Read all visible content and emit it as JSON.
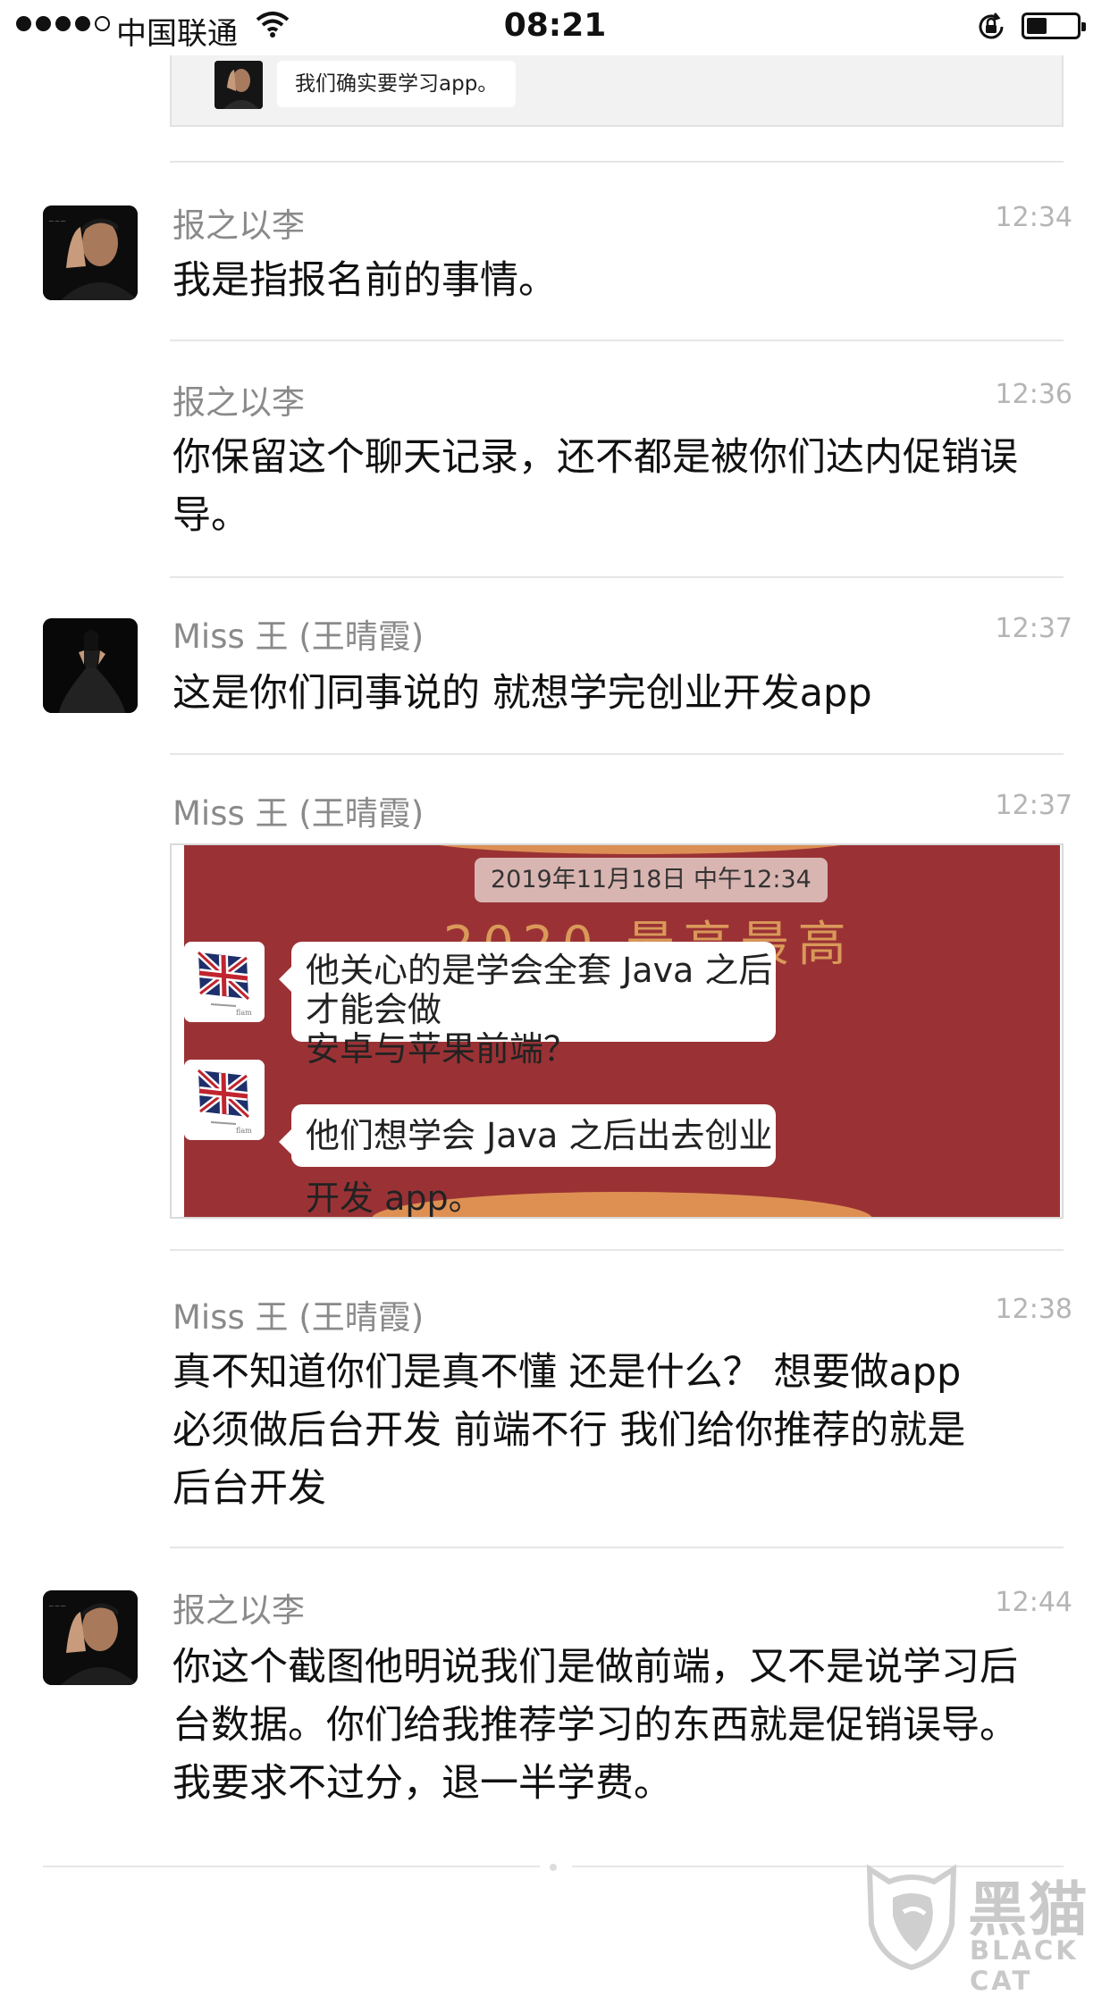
{
  "status_bar": {
    "carrier": "中国联通",
    "time": "08:21"
  },
  "quoted_message": {
    "text": "我们确实要学习app。"
  },
  "messages": [
    {
      "sender": "报之以李",
      "time": "12:34",
      "text": "我是指报名前的事情。"
    },
    {
      "sender": "报之以李",
      "time": "12:36",
      "lines": [
        "你保留这个聊天记录，还不都是被你们达内促销误",
        "导。"
      ]
    },
    {
      "sender": "Miss  王 (王晴霞)",
      "time": "12:37",
      "text": "这是你们同事说的  就想学完创业开发app"
    },
    {
      "sender": "Miss  王 (王晴霞)",
      "time": "12:37"
    },
    {
      "sender": "Miss  王 (王晴霞)",
      "time": "12:38",
      "lines": [
        "真不知道你们是真不懂  还是什么？  想要做app",
        "必须做后台开发    前端不行   我们给你推荐的就是",
        "后台开发"
      ]
    },
    {
      "sender": "报之以李",
      "time": "12:44",
      "lines": [
        "你这个截图他明说我们是做前端，又不是说学习后",
        "台数据。你们给我推荐学习的东西就是促销误导。",
        "我要求不过分，退一半学费。"
      ]
    }
  ],
  "screenshot_image": {
    "date_label": "2019年11月18日 中午12:34",
    "background_title": "2020 最高最高",
    "bubble1_lines": [
      "他关心的是学会全套 Java 之后才能会做",
      "安卓与苹果前端？"
    ],
    "bubble2": "他们想学会 Java 之后出去创业开发 app。"
  },
  "watermark": {
    "title": "黑猫",
    "subtitle": "BLACK CAT"
  }
}
